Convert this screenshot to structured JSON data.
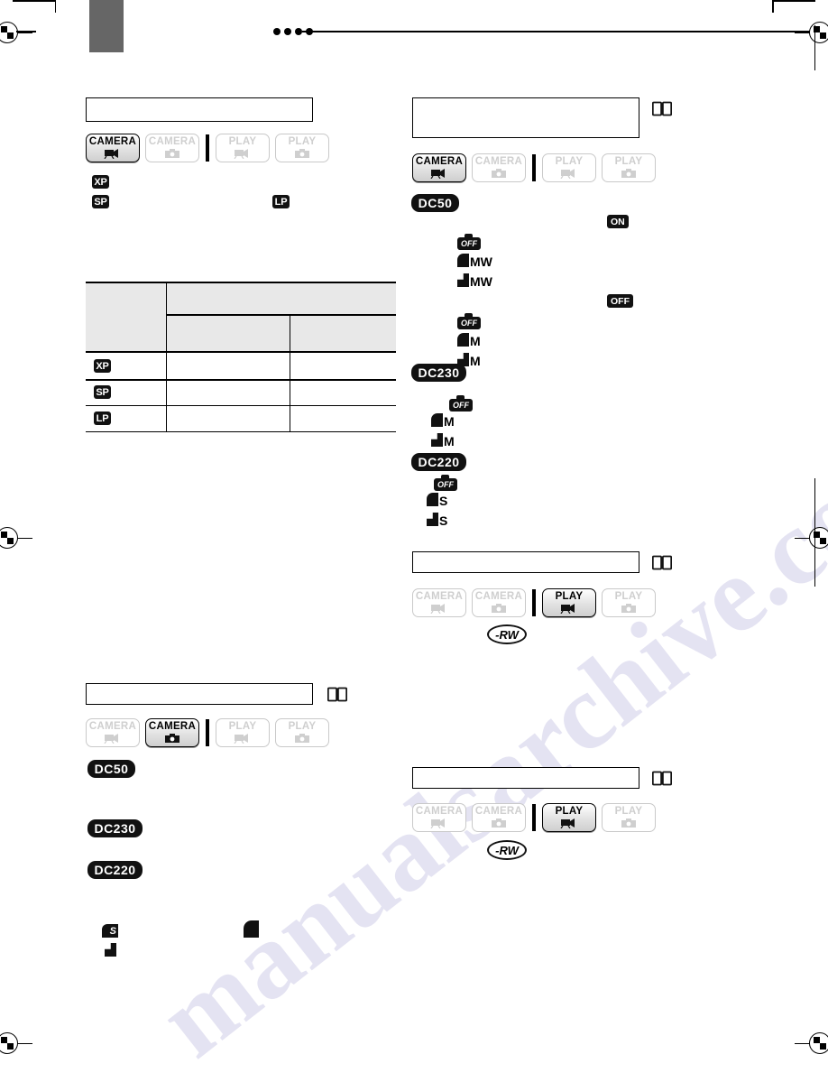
{
  "page": {
    "watermark": "manualsarchive.com",
    "tab_marker_color": "#666666"
  },
  "print_marks": {
    "registration_icon": "registration-target",
    "corner_icon": "crop-corner",
    "dots_count": 4
  },
  "icons": {
    "book": "open-book-icon",
    "camcorder": "camcorder-icon",
    "still_camera": "still-camera-icon"
  },
  "mode_bar": {
    "buttons": [
      {
        "label": "CAMERA",
        "glyph": "camcorder-icon",
        "state": "active"
      },
      {
        "label": "CAMERA",
        "glyph": "still-camera-icon",
        "state": "inactive"
      },
      {
        "label": "PLAY",
        "glyph": "camcorder-icon",
        "state": "inactive"
      },
      {
        "label": "PLAY",
        "glyph": "still-camera-icon",
        "state": "inactive"
      }
    ]
  },
  "sections": {
    "s1": {
      "title": "",
      "modes": [
        {
          "label": "CAMERA",
          "glyph": "camcorder-icon",
          "state": "active"
        },
        {
          "label": "CAMERA",
          "glyph": "still-camera-icon",
          "state": "inactive"
        },
        {
          "label": "PLAY",
          "glyph": "camcorder-icon",
          "state": "inactive"
        },
        {
          "label": "PLAY",
          "glyph": "still-camera-icon",
          "state": "inactive"
        }
      ],
      "rec_modes": [
        {
          "badge": "XP"
        },
        {
          "badge": "SP"
        },
        {
          "badge": "LP"
        }
      ]
    },
    "s2": {
      "title": "",
      "modes": [
        {
          "label": "CAMERA",
          "glyph": "camcorder-icon",
          "state": "active"
        },
        {
          "label": "CAMERA",
          "glyph": "still-camera-icon",
          "state": "inactive"
        },
        {
          "label": "PLAY",
          "glyph": "camcorder-icon",
          "state": "inactive"
        },
        {
          "label": "PLAY",
          "glyph": "still-camera-icon",
          "state": "inactive"
        }
      ],
      "model_badges": [
        "DC50",
        "DC230",
        "DC220"
      ],
      "state_badges": [
        "ON",
        "OFF"
      ],
      "quality_groups": [
        {
          "model": "DC50",
          "items": [
            "OFF",
            "MW",
            "MW"
          ]
        },
        {
          "model": "DC50",
          "items": [
            "OFF",
            "M",
            "M"
          ]
        },
        {
          "model": "DC230",
          "items": [
            "OFF",
            "M",
            "M"
          ]
        },
        {
          "model": "DC220",
          "items": [
            "OFF",
            "S",
            "S"
          ]
        }
      ]
    },
    "s3": {
      "title": "",
      "modes": [
        {
          "label": "CAMERA",
          "glyph": "camcorder-icon",
          "state": "inactive"
        },
        {
          "label": "CAMERA",
          "glyph": "still-camera-icon",
          "state": "inactive"
        },
        {
          "label": "PLAY",
          "glyph": "camcorder-icon",
          "state": "active"
        },
        {
          "label": "PLAY",
          "glyph": "still-camera-icon",
          "state": "inactive"
        }
      ],
      "disc_badge": "-RW"
    },
    "s4": {
      "title": "",
      "modes": [
        {
          "label": "CAMERA",
          "glyph": "camcorder-icon",
          "state": "inactive"
        },
        {
          "label": "CAMERA",
          "glyph": "still-camera-icon",
          "state": "active"
        },
        {
          "label": "PLAY",
          "glyph": "camcorder-icon",
          "state": "inactive"
        },
        {
          "label": "PLAY",
          "glyph": "still-camera-icon",
          "state": "inactive"
        }
      ],
      "model_badges": [
        "DC50",
        "DC230",
        "DC220"
      ]
    },
    "s5": {
      "title": "",
      "modes": [
        {
          "label": "CAMERA",
          "glyph": "camcorder-icon",
          "state": "inactive"
        },
        {
          "label": "CAMERA",
          "glyph": "still-camera-icon",
          "state": "inactive"
        },
        {
          "label": "PLAY",
          "glyph": "camcorder-icon",
          "state": "active"
        },
        {
          "label": "PLAY",
          "glyph": "still-camera-icon",
          "state": "inactive"
        }
      ],
      "disc_badge": "-RW"
    }
  },
  "table": {
    "header_row1": [
      ""
    ],
    "header_row2": [
      "",
      ""
    ],
    "row_badges": [
      "XP",
      "SP",
      "LP"
    ],
    "cells": [
      [
        "",
        ""
      ],
      [
        "",
        ""
      ],
      [
        "",
        ""
      ]
    ]
  },
  "colors": {
    "badge_black": "#111111",
    "table_header_fill": "#e8e8e8",
    "inactive_button_text": "#cfcfcf",
    "tab_gray": "#666666"
  }
}
